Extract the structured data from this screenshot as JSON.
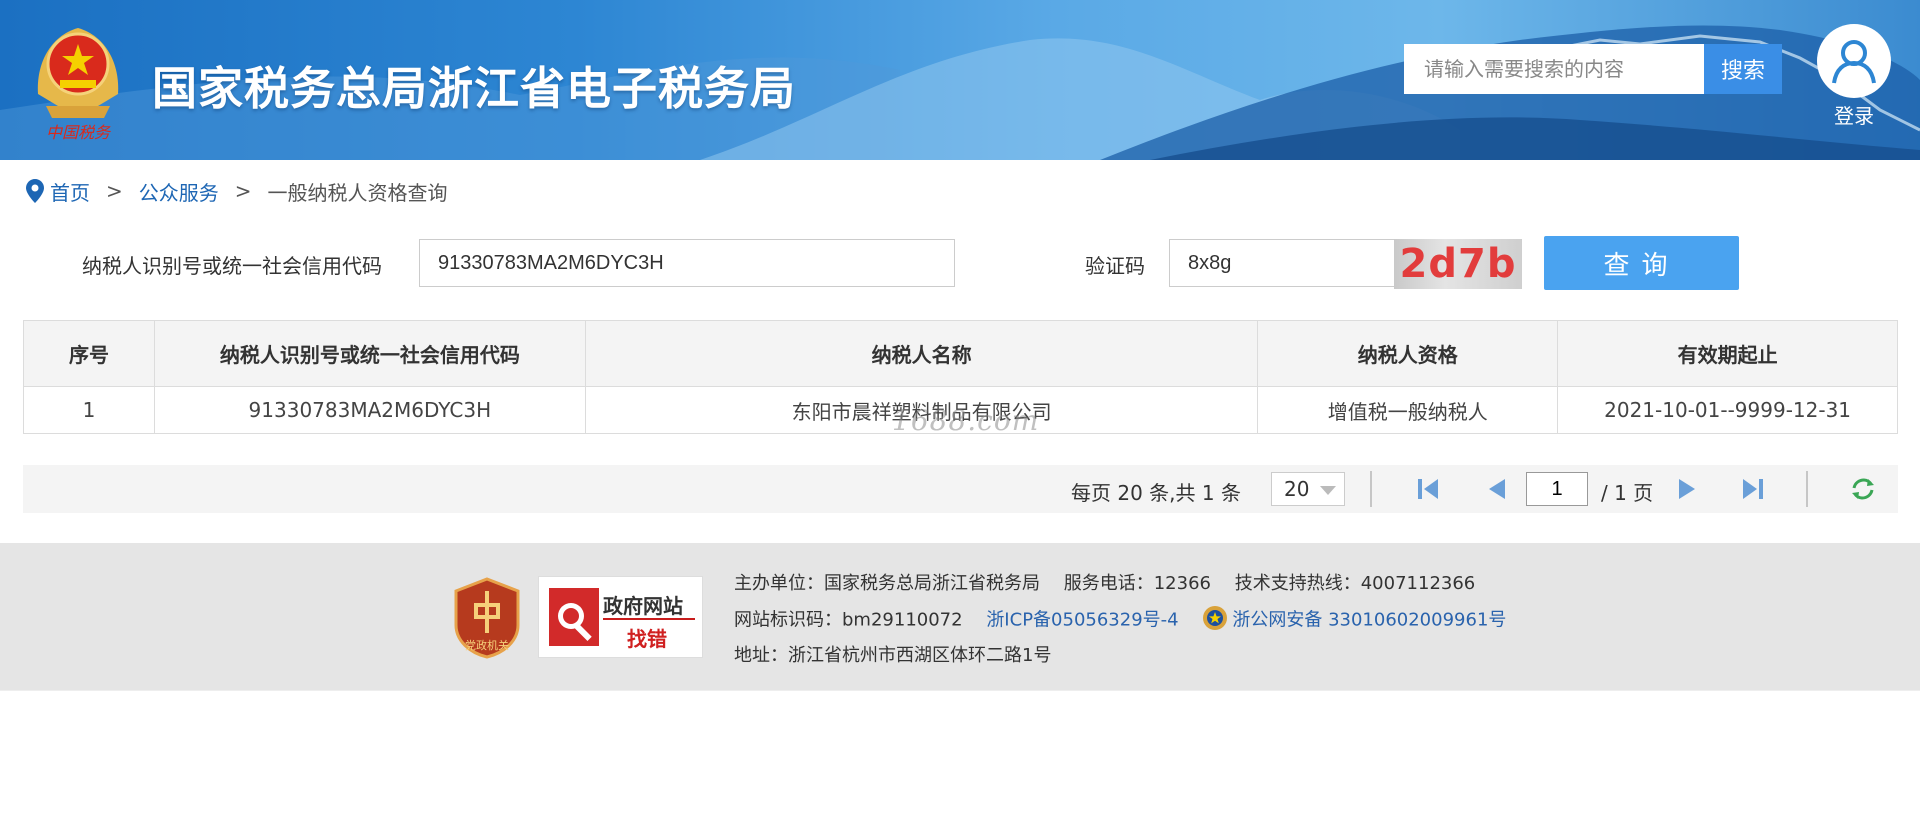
{
  "header": {
    "title": "国家税务总局浙江省电子税务局",
    "emblem_caption": "中国税务",
    "search_placeholder": "请输入需要搜索的内容",
    "search_button": "搜索",
    "login_label": "登录",
    "icons": {
      "emblem": "tax-emblem-icon",
      "user": "user-icon"
    }
  },
  "breadcrumb": {
    "items": [
      "首页",
      "公众服务",
      "一般纳税人资格查询"
    ],
    "separator": ">"
  },
  "form": {
    "taxpayer_id_label": "纳税人识别号或统一社会信用代码",
    "taxpayer_id_value": "91330783MA2M6DYC3H",
    "captcha_label": "验证码",
    "captcha_value": "8x8g",
    "captcha_image_text": "2d7b",
    "query_button": "查询"
  },
  "table": {
    "headers": [
      "序号",
      "纳税人识别号或统一社会信用代码",
      "纳税人名称",
      "纳税人资格",
      "有效期起止"
    ],
    "rows": [
      [
        "1",
        "91330783MA2M6DYC3H",
        "东阳市晨祥塑料制品有限公司",
        "增值税一般纳税人",
        "2021-10-01--9999-12-31"
      ]
    ]
  },
  "watermark": "1688.com",
  "pagination": {
    "summary": "每页 20 条,共 1 条",
    "page_size": "20",
    "current_page": "1",
    "total_pages": "/ 1 页"
  },
  "footer": {
    "badge_party": "党政机关",
    "badge_gov_line1": "政府网站",
    "badge_gov_line2": "找错",
    "host": "主办单位：国家税务总局浙江省税务局",
    "service_phone": "服务电话：12366",
    "support_phone": "技术支持热线：4007112366",
    "site_code": "网站标识码：bm29110072",
    "icp": "浙ICP备05056329号-4",
    "police_record": "浙公网安备 33010602009961号",
    "address": "地址：浙江省杭州市西湖区体环二路1号"
  },
  "colors": {
    "header_blue": "#2d86d3",
    "link_blue": "#1d66b4",
    "button_blue": "#4aa3f0",
    "captcha_red": "#e23c3c",
    "footer_bg": "#e5e5e5"
  }
}
